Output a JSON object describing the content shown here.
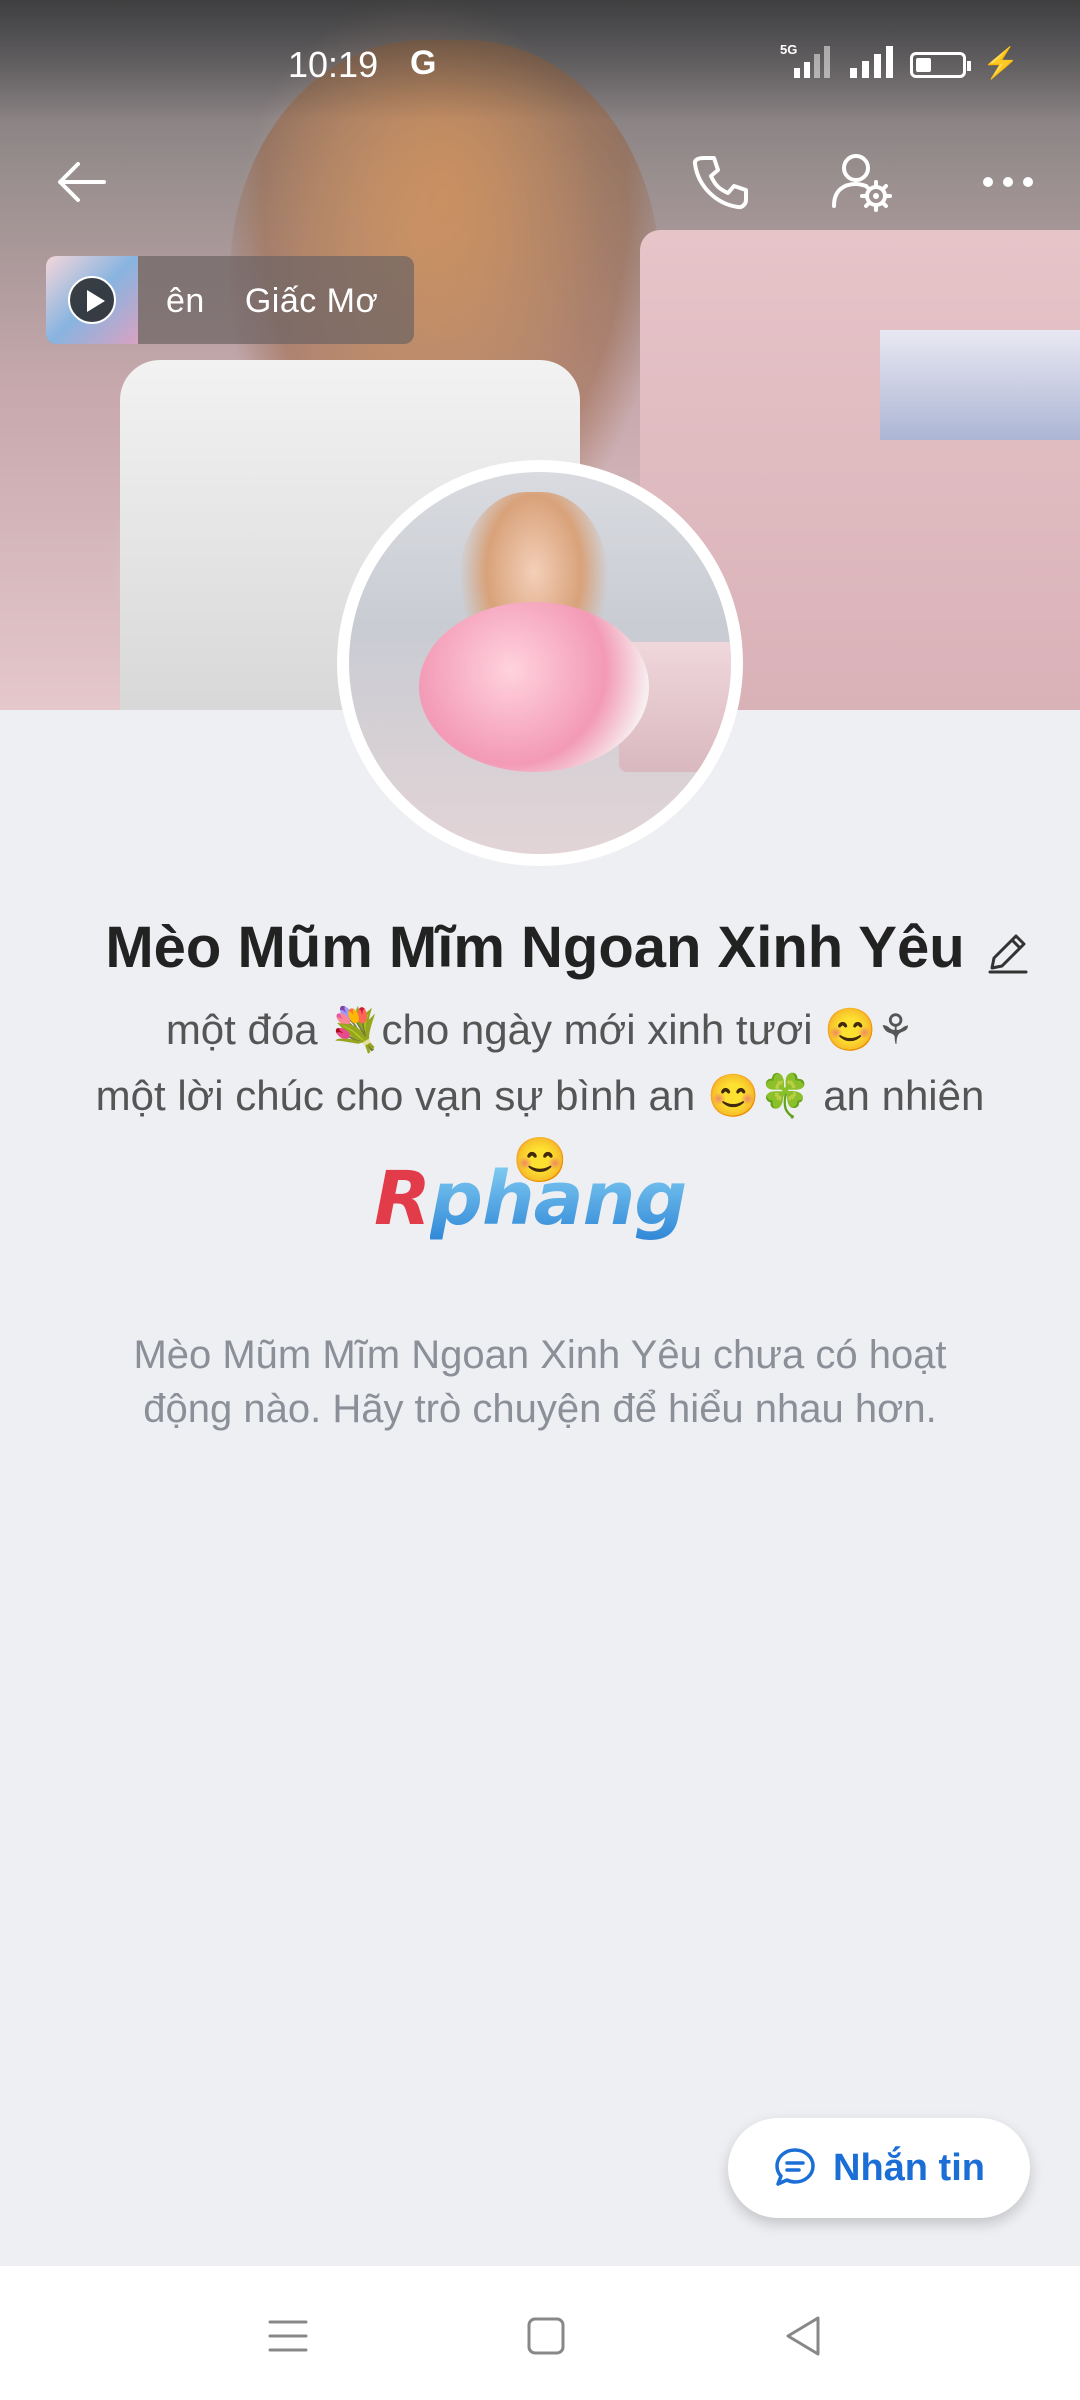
{
  "status_bar": {
    "time": "10:19",
    "carrier_icon": "G",
    "network": "5G",
    "battery_level": 0.35
  },
  "header": {
    "back_icon": "arrow-left-icon",
    "call_icon": "phone-icon",
    "settings_icon": "user-settings-icon",
    "more_icon": "more-horizontal-icon"
  },
  "music": {
    "track_text_1": "ên",
    "track_text_2": "Giấc Mơ"
  },
  "profile": {
    "name": "Mèo Mũm Mĩm Ngoan Xinh Yêu",
    "bio_line_1": "một đóa 💐cho ngày mới xinh tươi 😊⚘",
    "bio_line_2": "một lời chúc cho vạn sự bình an 😊🍀 an  nhiên",
    "bio_line_3": "😊",
    "logo_r": "R",
    "logo_rest": "phang"
  },
  "empty_state": {
    "message": "Mèo Mũm Mĩm Ngoan Xinh Yêu chưa có hoạt động nào. Hãy trò chuyện để hiểu nhau hơn."
  },
  "actions": {
    "message_button_label": "Nhắn tin"
  },
  "colors": {
    "accent": "#1a6ed6",
    "background": "#eeeff3"
  }
}
